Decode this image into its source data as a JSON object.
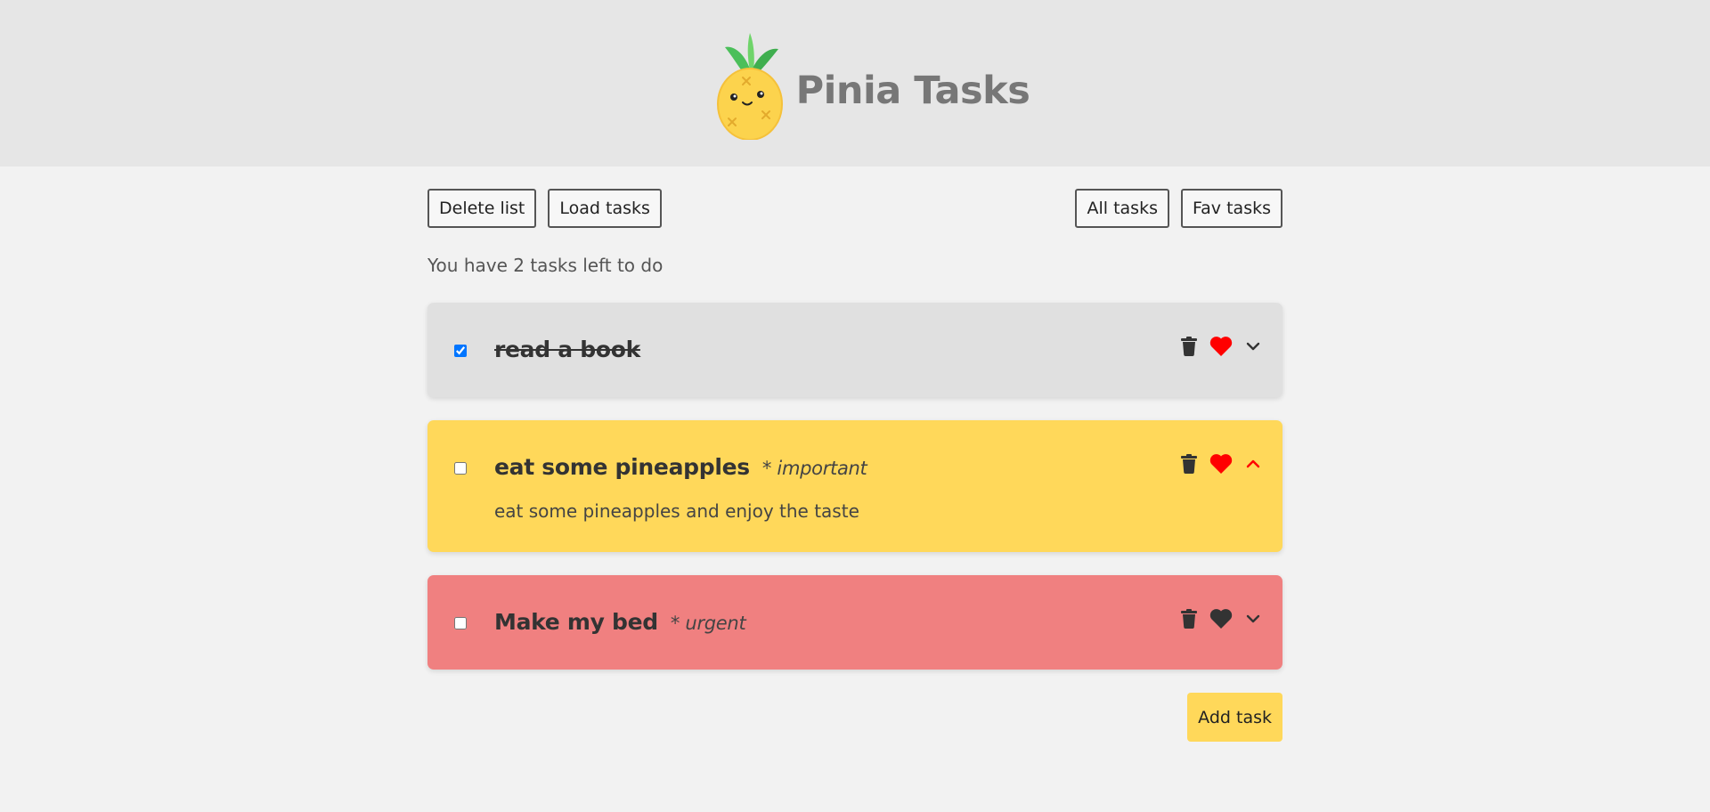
{
  "header": {
    "title": "Pinia Tasks",
    "logo": "pineapple-logo"
  },
  "toolbar": {
    "delete_list": "Delete list",
    "load_tasks": "Load tasks",
    "all_tasks": "All tasks",
    "fav_tasks": "Fav tasks"
  },
  "summary": "You have 2 tasks left to do",
  "tasks": [
    {
      "title": "read a book",
      "tag": "",
      "completed": true,
      "favorite": true,
      "expanded": false,
      "description": "",
      "bg": "#e0e0e0"
    },
    {
      "title": "eat some pineapples",
      "tag": "* important",
      "completed": false,
      "favorite": true,
      "expanded": true,
      "description": "eat some pineapples and enjoy the taste",
      "bg": "#ffd85a"
    },
    {
      "title": "Make my bed",
      "tag": "* urgent",
      "completed": false,
      "favorite": false,
      "expanded": false,
      "description": "",
      "bg": "#f08080"
    }
  ],
  "add_task": "Add task",
  "colors": {
    "heart_fav": "#ff0000",
    "heart_plain": "#333333",
    "icon": "#333333",
    "chevron_open": "#ff0000",
    "add_btn": "#ffd85a"
  }
}
